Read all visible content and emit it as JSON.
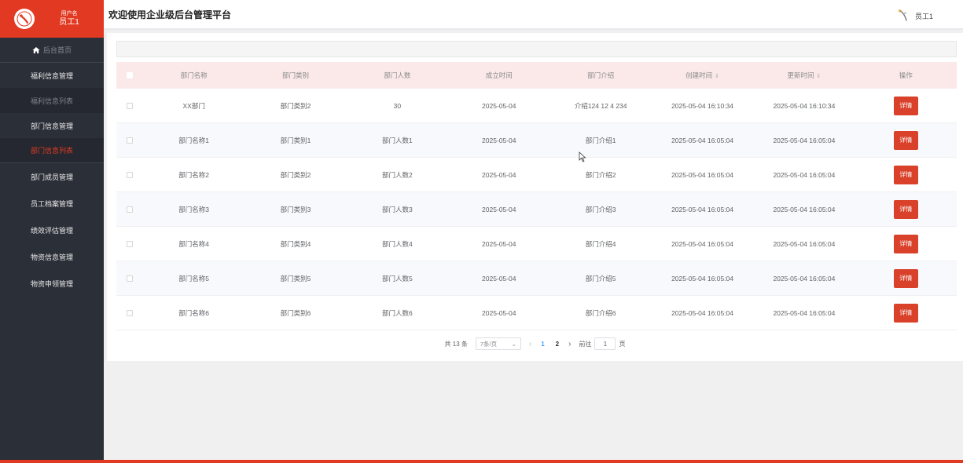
{
  "user": {
    "label": "用户名",
    "name": "员工1"
  },
  "sidebar": {
    "home": "后台首页",
    "items": [
      {
        "label": "福利信息管理"
      },
      {
        "label": "福利信息列表"
      },
      {
        "label": "部门信息管理"
      },
      {
        "label": "部门信息列表"
      },
      {
        "label": "部门成员管理"
      },
      {
        "label": "员工档案管理"
      },
      {
        "label": "绩效评估管理"
      },
      {
        "label": "物资信息管理"
      },
      {
        "label": "物资申领管理"
      }
    ]
  },
  "header": {
    "title": "欢迎使用企业级后台管理平台",
    "user": "员工1"
  },
  "table": {
    "columns": [
      "部门名称",
      "部门类别",
      "部门人数",
      "成立时间",
      "部门介绍",
      "创建时间",
      "更新时间",
      "操作"
    ],
    "sort_icon": "⇕",
    "rows": [
      [
        "XX部门",
        "部门类别2",
        "30",
        "2025-05-04",
        "介绍124 12 4 234",
        "2025-05-04 16:10:34",
        "2025-05-04 16:10:34",
        "详情"
      ],
      [
        "部门名称1",
        "部门类别1",
        "部门人数1",
        "2025-05-04",
        "部门介绍1",
        "2025-05-04 16:05:04",
        "2025-05-04 16:05:04",
        "详情"
      ],
      [
        "部门名称2",
        "部门类别2",
        "部门人数2",
        "2025-05-04",
        "部门介绍2",
        "2025-05-04 16:05:04",
        "2025-05-04 16:05:04",
        "详情"
      ],
      [
        "部门名称3",
        "部门类别3",
        "部门人数3",
        "2025-05-04",
        "部门介绍3",
        "2025-05-04 16:05:04",
        "2025-05-04 16:05:04",
        "详情"
      ],
      [
        "部门名称4",
        "部门类别4",
        "部门人数4",
        "2025-05-04",
        "部门介绍4",
        "2025-05-04 16:05:04",
        "2025-05-04 16:05:04",
        "详情"
      ],
      [
        "部门名称5",
        "部门类别5",
        "部门人数5",
        "2025-05-04",
        "部门介绍5",
        "2025-05-04 16:05:04",
        "2025-05-04 16:05:04",
        "详情"
      ],
      [
        "部门名称6",
        "部门类别6",
        "部门人数6",
        "2025-05-04",
        "部门介绍6",
        "2025-05-04 16:05:04",
        "2025-05-04 16:05:04",
        "详情"
      ]
    ]
  },
  "pagination": {
    "total": "共 13 条",
    "page_size": "7条/页",
    "prev": "‹",
    "pages": [
      "1",
      "2"
    ],
    "next": "›",
    "goto_label": "前往",
    "goto_value": "1",
    "page_suffix": "页"
  },
  "colors": {
    "accent": "#e23a22",
    "sidebar": "#2b2f38",
    "header_row": "#fbe9e9",
    "button": "#d9412a",
    "current_page": "#409eff"
  }
}
